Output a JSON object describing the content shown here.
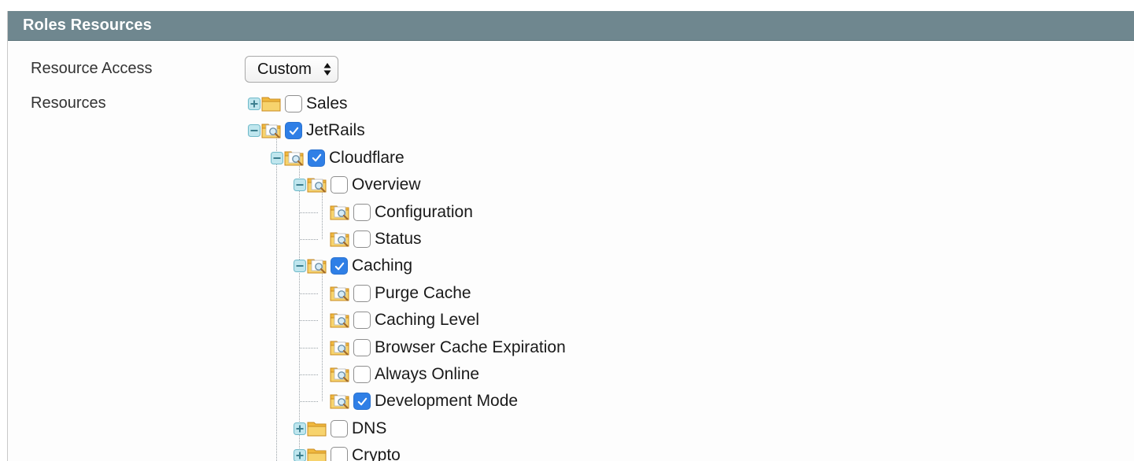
{
  "panel": {
    "title": "Roles Resources"
  },
  "form": {
    "resource_access_label": "Resource Access",
    "resource_access_value": "Custom",
    "resources_label": "Resources"
  },
  "tree": [
    {
      "label": "Sales",
      "checked": false,
      "level": 0,
      "expander": "plus",
      "folder": "closed"
    },
    {
      "label": "JetRails",
      "checked": true,
      "level": 0,
      "expander": "minus",
      "folder": "open"
    },
    {
      "label": "Cloudflare",
      "checked": true,
      "level": 1,
      "expander": "minus",
      "folder": "open"
    },
    {
      "label": "Overview",
      "checked": false,
      "level": 2,
      "expander": "minus",
      "folder": "open"
    },
    {
      "label": "Configuration",
      "checked": false,
      "level": 3,
      "expander": "none",
      "folder": "open"
    },
    {
      "label": "Status",
      "checked": false,
      "level": 3,
      "expander": "none",
      "folder": "open"
    },
    {
      "label": "Caching",
      "checked": true,
      "level": 2,
      "expander": "minus",
      "folder": "open"
    },
    {
      "label": "Purge Cache",
      "checked": false,
      "level": 3,
      "expander": "none",
      "folder": "open"
    },
    {
      "label": "Caching Level",
      "checked": false,
      "level": 3,
      "expander": "none",
      "folder": "open"
    },
    {
      "label": "Browser Cache Expiration",
      "checked": false,
      "level": 3,
      "expander": "none",
      "folder": "open"
    },
    {
      "label": "Always Online",
      "checked": false,
      "level": 3,
      "expander": "none",
      "folder": "open"
    },
    {
      "label": "Development Mode",
      "checked": true,
      "level": 3,
      "expander": "none",
      "folder": "open"
    },
    {
      "label": "DNS",
      "checked": false,
      "level": 2,
      "expander": "plus",
      "folder": "closed"
    },
    {
      "label": "Crypto",
      "checked": false,
      "level": 2,
      "expander": "plus",
      "folder": "closed"
    }
  ],
  "colors": {
    "header_bg": "#6f878f",
    "checkbox_checked": "#2f7fe6",
    "folder": "#f3c454"
  },
  "icons": {
    "expand": "plus-square-icon",
    "collapse": "minus-square-icon",
    "folder_closed": "folder-icon",
    "folder_open": "folder-search-icon",
    "checkmark": "checkmark-icon",
    "select_arrows": "up-down-arrows-icon"
  }
}
